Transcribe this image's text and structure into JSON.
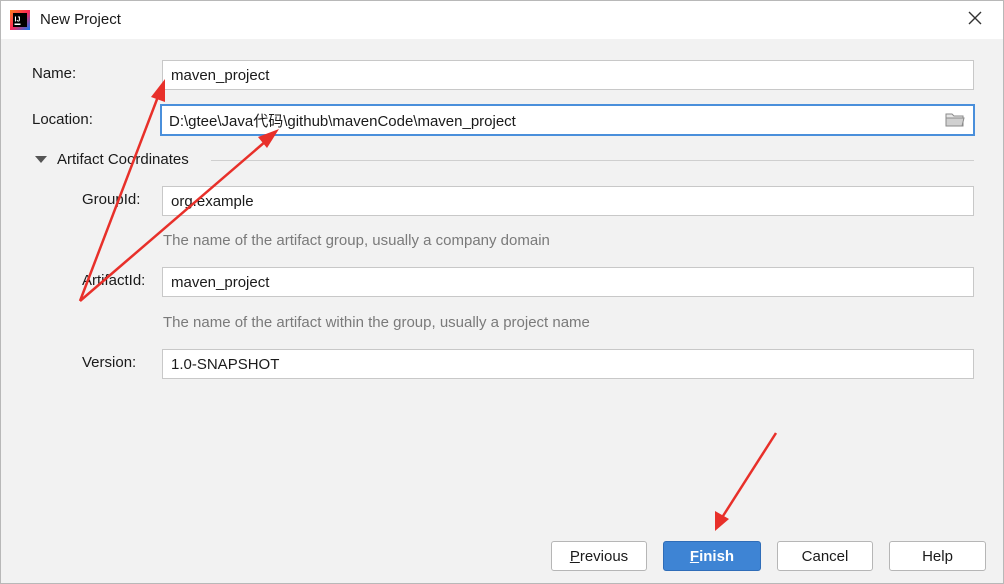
{
  "window": {
    "title": "New Project"
  },
  "form": {
    "name": {
      "label": "Name:",
      "value": "maven_project"
    },
    "location": {
      "label": "Location:",
      "value": "D:\\gtee\\Java代码\\github\\mavenCode\\maven_project"
    },
    "section_title": "Artifact Coordinates",
    "group_id": {
      "label": "GroupId:",
      "value": "org.example",
      "hint": "The name of the artifact group, usually a company domain"
    },
    "artifact_id": {
      "label": "ArtifactId:",
      "value": "maven_project",
      "hint": "The name of the artifact within the group, usually a project name"
    },
    "version": {
      "label": "Version:",
      "value": "1.0-SNAPSHOT"
    }
  },
  "buttons": {
    "previous": {
      "mnemonic": "P",
      "rest": "revious"
    },
    "finish": {
      "mnemonic": "F",
      "rest": "inish"
    },
    "cancel": "Cancel",
    "help": "Help"
  },
  "colors": {
    "accent": "#3e84d4",
    "annotation": "#e8302a",
    "focus_border": "#4a8fdb"
  },
  "icons": [
    "intellij-app-icon",
    "close-icon",
    "folder-icon",
    "collapse-triangle-icon"
  ]
}
